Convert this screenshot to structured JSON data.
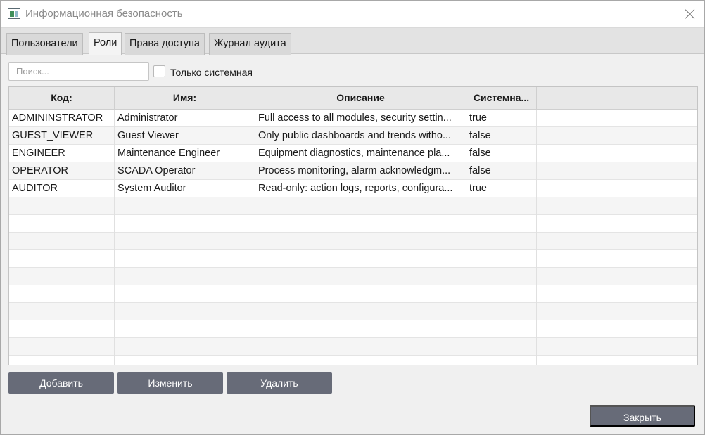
{
  "window": {
    "title": "Информационная безопасность",
    "close_icon": "close-icon",
    "app_icon": "app-window-icon"
  },
  "tabs": [
    {
      "label": "Пользователи",
      "active": false
    },
    {
      "label": "Роли",
      "active": true
    },
    {
      "label": "Права доступа",
      "active": false
    },
    {
      "label": "Журнал аудита",
      "active": false
    }
  ],
  "filter": {
    "search_placeholder": "Поиск...",
    "search_value": "",
    "system_only_label": "Только системная",
    "system_only_checked": false
  },
  "table": {
    "columns": [
      "Код:",
      "Имя:",
      "Описание",
      "Системна..."
    ],
    "rows": [
      [
        "ADMININSTRATOR",
        "Administrator",
        "Full access to all modules, security settin...",
        "true"
      ],
      [
        "GUEST_VIEWER",
        "Guest Viewer",
        "Only public dashboards and trends witho...",
        "false"
      ],
      [
        "ENGINEER",
        "Maintenance Engineer",
        "Equipment diagnostics, maintenance pla...",
        "false"
      ],
      [
        "OPERATOR",
        "SCADA Operator",
        "Process monitoring, alarm acknowledgm...",
        "false"
      ],
      [
        "AUDITOR",
        "System Auditor",
        "Read-only: action logs, reports, configura...",
        "true"
      ]
    ]
  },
  "actions": {
    "add_label": "Добавить",
    "edit_label": "Изменить",
    "delete_label": "Удалить",
    "close_label": "Закрыть"
  },
  "colors": {
    "button_bg": "#676b78",
    "grid_header_bg": "#e8e8e8",
    "window_bg": "#f0f0f0"
  }
}
